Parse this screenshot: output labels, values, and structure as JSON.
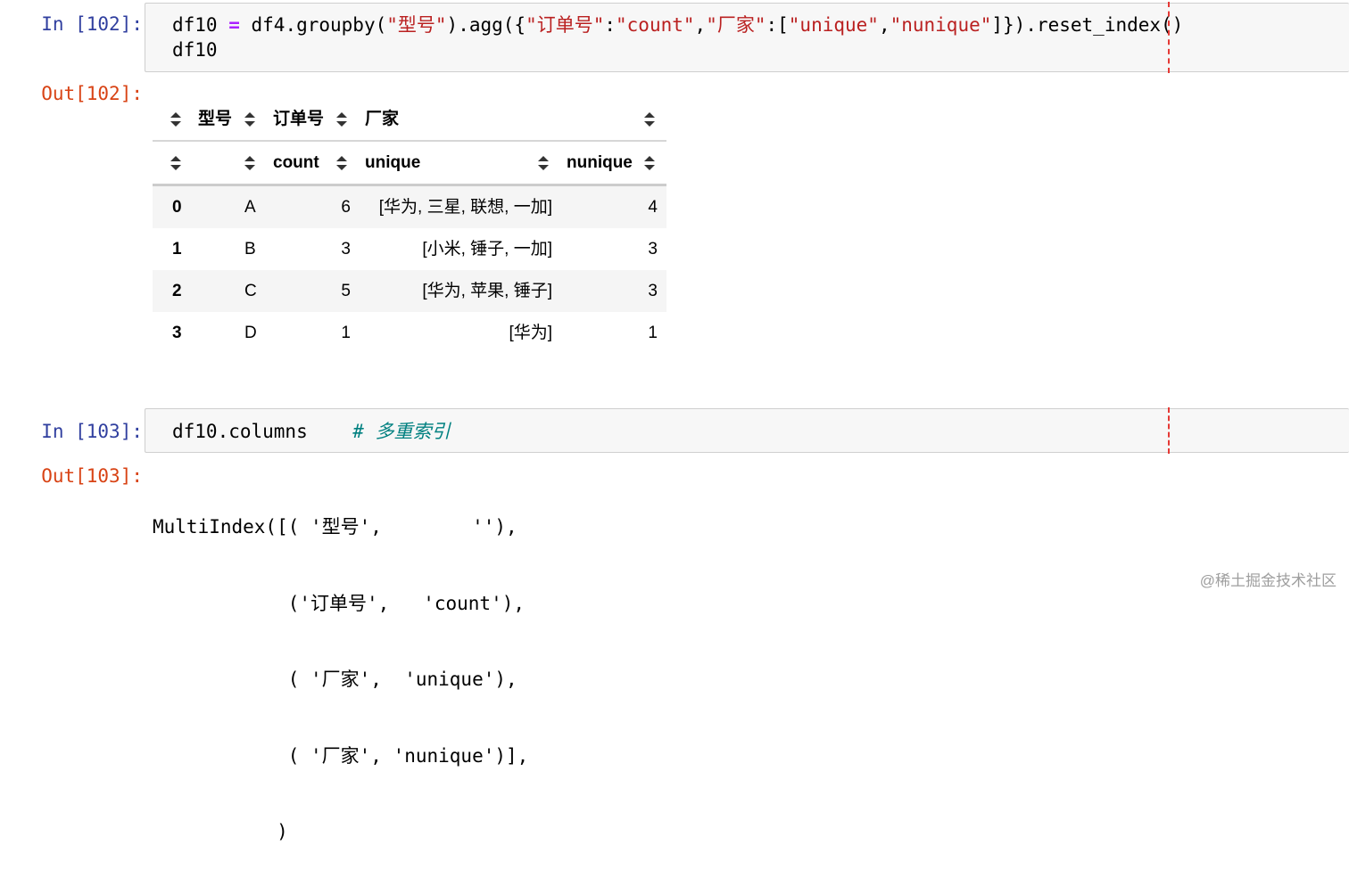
{
  "cells": [
    {
      "in_prompt": "In [102]:",
      "code_tokens": [
        {
          "t": "df10 ",
          "c": ""
        },
        {
          "t": "=",
          "c": "op"
        },
        {
          "t": " df4.groupby(",
          "c": ""
        },
        {
          "t": "\"型号\"",
          "c": "str"
        },
        {
          "t": ").agg({",
          "c": ""
        },
        {
          "t": "\"订单号\"",
          "c": "str"
        },
        {
          "t": ":",
          "c": ""
        },
        {
          "t": "\"count\"",
          "c": "str"
        },
        {
          "t": ",",
          "c": ""
        },
        {
          "t": "\"厂家\"",
          "c": "str"
        },
        {
          "t": ":[",
          "c": ""
        },
        {
          "t": "\"unique\"",
          "c": "str"
        },
        {
          "t": ",",
          "c": ""
        },
        {
          "t": "\"nunique\"",
          "c": "str"
        },
        {
          "t": "]}).reset_index()",
          "c": ""
        }
      ],
      "code_line2": "df10",
      "out_prompt": "Out[102]:"
    },
    {
      "in_prompt": "In [103]:",
      "code": "df10.columns",
      "comment": "# 多重索引",
      "out_prompt": "Out[103]:",
      "output_lines": [
        "MultiIndex([( '型号',        ''),",
        "            ('订单号',   'count'),",
        "            ( '厂家',  'unique'),",
        "            ( '厂家', 'nunique')],",
        "           )"
      ]
    }
  ],
  "table": {
    "header_row1": [
      "型号",
      "订单号",
      "厂家"
    ],
    "header_row2": [
      "count",
      "unique",
      "nunique"
    ],
    "rows": [
      {
        "index": "0",
        "model": "A",
        "count": "6",
        "unique": "[华为, 三星, 联想, 一加]",
        "nunique": "4"
      },
      {
        "index": "1",
        "model": "B",
        "count": "3",
        "unique": "[小米, 锤子, 一加]",
        "nunique": "3"
      },
      {
        "index": "2",
        "model": "C",
        "count": "5",
        "unique": "[华为, 苹果, 锤子]",
        "nunique": "3"
      },
      {
        "index": "3",
        "model": "D",
        "count": "1",
        "unique": "[华为]",
        "nunique": "1"
      }
    ]
  },
  "watermark": "@稀土掘金技术社区",
  "colors": {
    "in_prompt": "#303f9f",
    "out_prompt": "#d84315",
    "string": "#ba2121",
    "operator": "#aa22ff",
    "comment": "#008080",
    "ruler": "#e53935"
  }
}
